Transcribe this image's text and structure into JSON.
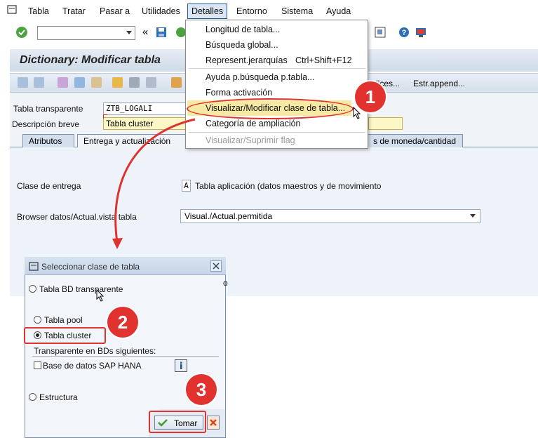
{
  "menubar": {
    "items": [
      "Tabla",
      "Tratar",
      "Pasar a",
      "Utilidades",
      "Detalles",
      "Entorno",
      "Sistema",
      "Ayuda"
    ]
  },
  "toolbar": {
    "cmd_placeholder": "",
    "back_glyph": "«"
  },
  "screen": {
    "title": "Dictionary: Modificar tabla"
  },
  "app_toolbar": {
    "btn_indices": "dices...",
    "btn_estr_append": "Estr.append..."
  },
  "form": {
    "tabla_label": "Tabla transparente",
    "tabla_value": "ZTB_LOGALI",
    "desc_label": "Descripción breve",
    "desc_value": "Tabla cluster"
  },
  "tabs": [
    {
      "label": "Atributos"
    },
    {
      "label": "Entrega y actualización"
    },
    {
      "label": "s de moneda/cantidad"
    }
  ],
  "tab_content": {
    "clase_label": "Clase de entrega",
    "clase_code": "A",
    "clase_text": "Tabla aplicación (datos maestros y de movimiento",
    "browser_label": "Browser datos/Actual.vista tabla",
    "browser_value": "Visual./Actual.permitida"
  },
  "details_menu": {
    "items": [
      {
        "label": "Longitud de tabla...",
        "shortcut": ""
      },
      {
        "label": "Búsqueda global...",
        "shortcut": ""
      },
      {
        "label": "Represent.jerarquías",
        "shortcut": "Ctrl+Shift+F12"
      },
      {
        "label": "Ayuda p.búsqueda p.tabla...",
        "shortcut": ""
      },
      {
        "label": "Forma activación",
        "shortcut": ""
      },
      {
        "label": "Visualizar/Modificar clase de tabla...",
        "shortcut": ""
      },
      {
        "label": "Categoría de ampliación",
        "shortcut": ""
      },
      {
        "label": "Visualizar/Suprimir flag",
        "shortcut": ""
      }
    ]
  },
  "dialog": {
    "title": "Seleccionar clase de tabla",
    "opt_transparente": "Tabla BD transparente",
    "partial_text": "o",
    "opt_pool": "Tabla pool",
    "opt_cluster": "Tabla cluster",
    "group_label": "Transparente en BDs siguientes:",
    "chk_hana": "Base de datos SAP HANA",
    "opt_estructura": "Estructura",
    "btn_tomar": "Tomar",
    "selected": "cluster"
  },
  "annotations": {
    "step1": "1",
    "step2": "2",
    "step3": "3"
  },
  "colors": {
    "annotation_red": "#e0322f",
    "menu_highlight": "#f7e9a3"
  }
}
